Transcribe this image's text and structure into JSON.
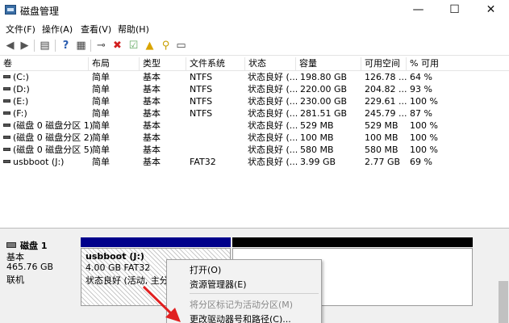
{
  "window": {
    "title": "磁盘管理",
    "minimize": "—",
    "maximize": "☐",
    "close": "✕"
  },
  "menu": [
    "文件(F)",
    "操作(A)",
    "查看(V)",
    "帮助(H)"
  ],
  "columns": [
    "卷",
    "布局",
    "类型",
    "文件系统",
    "状态",
    "容量",
    "可用空间",
    "% 可用"
  ],
  "volumes": [
    {
      "name": "(C:)",
      "layout": "简单",
      "type": "基本",
      "fs": "NTFS",
      "status": "状态良好 (...",
      "capacity": "198.80 GB",
      "free": "126.78 ...",
      "pct": "64 %"
    },
    {
      "name": "(D:)",
      "layout": "简单",
      "type": "基本",
      "fs": "NTFS",
      "status": "状态良好 (...",
      "capacity": "220.00 GB",
      "free": "204.82 ...",
      "pct": "93 %"
    },
    {
      "name": "(E:)",
      "layout": "简单",
      "type": "基本",
      "fs": "NTFS",
      "status": "状态良好 (...",
      "capacity": "230.00 GB",
      "free": "229.61 ...",
      "pct": "100 %"
    },
    {
      "name": "(F:)",
      "layout": "简单",
      "type": "基本",
      "fs": "NTFS",
      "status": "状态良好 (...",
      "capacity": "281.51 GB",
      "free": "245.79 ...",
      "pct": "87 %"
    },
    {
      "name": "(磁盘 0 磁盘分区 1)",
      "layout": "简单",
      "type": "基本",
      "fs": "",
      "status": "状态良好 (...",
      "capacity": "529 MB",
      "free": "529 MB",
      "pct": "100 %"
    },
    {
      "name": "(磁盘 0 磁盘分区 2)",
      "layout": "简单",
      "type": "基本",
      "fs": "",
      "status": "状态良好 (...",
      "capacity": "100 MB",
      "free": "100 MB",
      "pct": "100 %"
    },
    {
      "name": "(磁盘 0 磁盘分区 5)",
      "layout": "简单",
      "type": "基本",
      "fs": "",
      "status": "状态良好 (...",
      "capacity": "580 MB",
      "free": "580 MB",
      "pct": "100 %"
    },
    {
      "name": "usbboot (J:)",
      "layout": "简单",
      "type": "基本",
      "fs": "FAT32",
      "status": "状态良好 (...",
      "capacity": "3.99 GB",
      "free": "2.77 GB",
      "pct": "69 %"
    }
  ],
  "disk": {
    "name": "磁盘 1",
    "type": "基本",
    "size": "465.76 GB",
    "state": "联机"
  },
  "partition": {
    "name": "usbboot  (J:)",
    "size_fs": "4.00 GB FAT32",
    "status": "状态良好 (活动, 主分区"
  },
  "context_menu": {
    "open": "打开(O)",
    "explorer": "资源管理器(E)",
    "mark_active": "将分区标记为活动分区(M)",
    "change_letter": "更改驱动器号和路径(C)..."
  },
  "colors": {
    "primary_bar": "#00008b",
    "unallocated_bar": "#000000",
    "arrow": "#e02020"
  }
}
